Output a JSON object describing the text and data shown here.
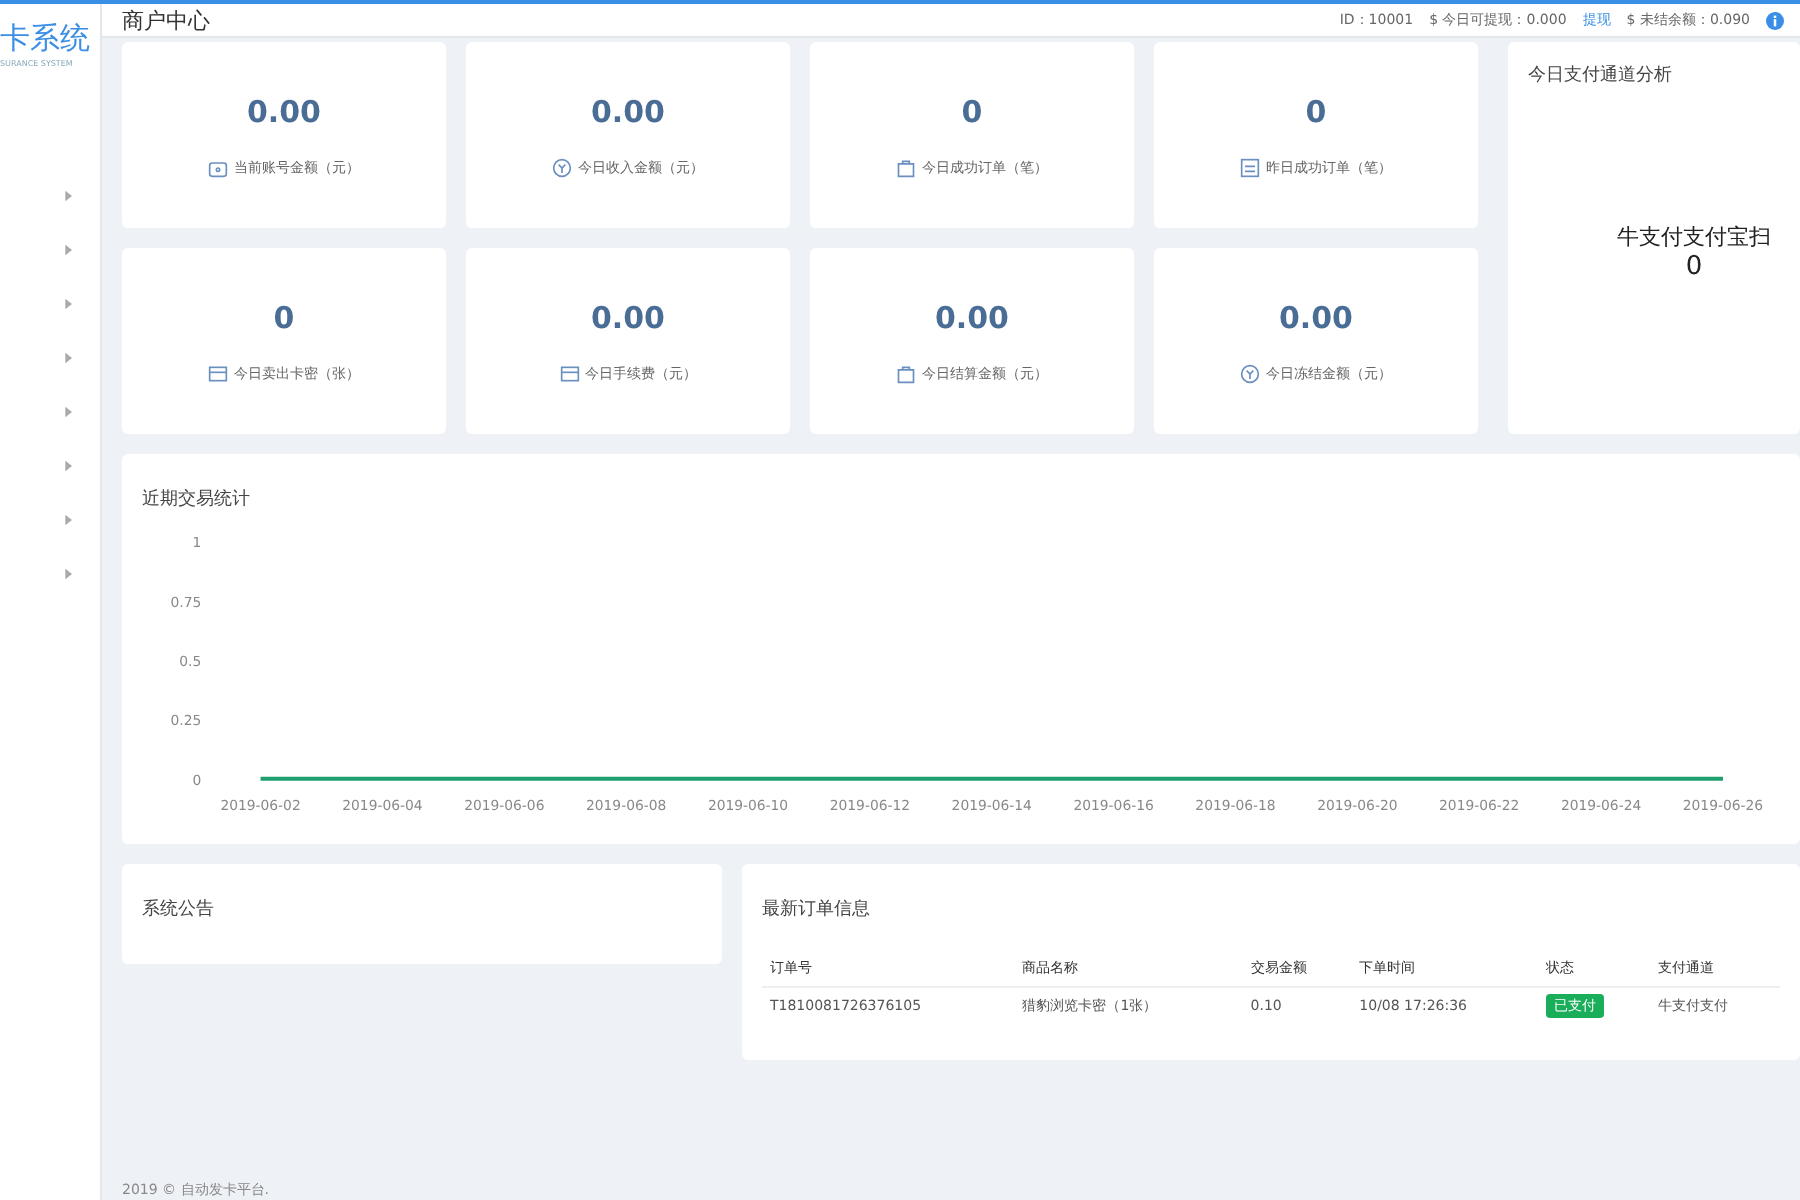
{
  "logo": {
    "title": "卡系统",
    "subtitle": "SURANCE SYSTEM"
  },
  "header": {
    "title": "商户中心",
    "id": "ID：10001",
    "withdrawable": "$ 今日可提现：0.000",
    "withdraw_link": "提现",
    "unsettled": "$ 未结余额：0.090"
  },
  "sidebar": {
    "items": [
      {
        "expanded": false
      },
      {
        "expanded": false
      },
      {
        "expanded": false
      },
      {
        "expanded": false
      },
      {
        "expanded": false
      },
      {
        "expanded": false
      },
      {
        "expanded": false
      },
      {
        "expanded": false
      }
    ]
  },
  "stats": [
    {
      "value": "0.00",
      "label": "当前账号金额（元）",
      "kind": "wallet"
    },
    {
      "value": "0.00",
      "label": "今日收入金额（元）",
      "kind": "coin"
    },
    {
      "value": "0",
      "label": "今日成功订单（笔）",
      "kind": "bag"
    },
    {
      "value": "0",
      "label": "昨日成功订单（笔）",
      "kind": "list"
    },
    {
      "value": "0",
      "label": "今日卖出卡密（张）",
      "kind": "card"
    },
    {
      "value": "0.00",
      "label": "今日手续费（元）",
      "kind": "card"
    },
    {
      "value": "0.00",
      "label": "今日结算金额（元）",
      "kind": "bag"
    },
    {
      "value": "0.00",
      "label": "今日冻结金额（元）",
      "kind": "coin"
    }
  ],
  "channel_panel": {
    "title": "今日支付通道分析",
    "legend": "牛支付支付宝扫",
    "value": "0"
  },
  "trend": {
    "title": "近期交易统计",
    "chart_data": {
      "type": "line",
      "categories": [
        "2019-06-02",
        "2019-06-04",
        "2019-06-06",
        "2019-06-08",
        "2019-06-10",
        "2019-06-12",
        "2019-06-14",
        "2019-06-16",
        "2019-06-18",
        "2019-06-20",
        "2019-06-22",
        "2019-06-24",
        "2019-06-26"
      ],
      "series": [
        {
          "color": "#1f9e6e",
          "values": [
            0,
            0,
            0,
            0,
            0,
            0,
            0,
            0,
            0,
            0,
            0,
            0,
            0
          ]
        }
      ],
      "ylim": [
        0,
        1
      ],
      "yticks": [
        0,
        0.25,
        0.5,
        0.75,
        1
      ]
    }
  },
  "notice": {
    "title": "系统公告"
  },
  "orders": {
    "title": "最新订单信息",
    "columns": [
      "订单号",
      "商品名称",
      "交易金额",
      "下单时间",
      "状态",
      "支付通道"
    ],
    "rows": [
      {
        "order_no": "T1810081726376105",
        "product": "猎豹浏览卡密（1张）",
        "amount": "0.10",
        "time": "10/08 17:26:36",
        "status": "已支付",
        "paid": true,
        "channel": "牛支付支付"
      }
    ]
  },
  "footer": "2019 © 自动发卡平台."
}
